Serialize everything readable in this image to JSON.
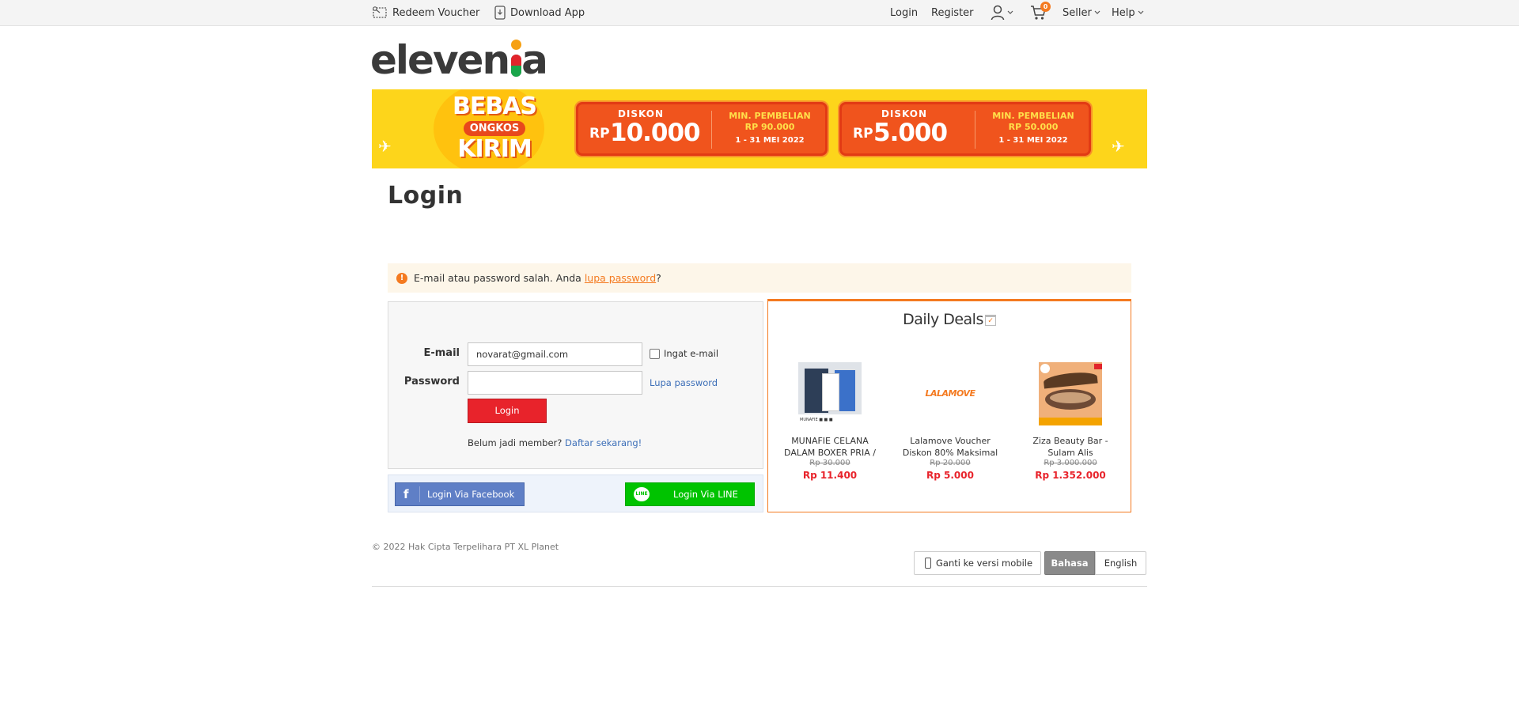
{
  "topbar": {
    "redeem_voucher": "Redeem Voucher",
    "download_app": "Download App",
    "login": "Login",
    "register": "Register",
    "cart_count": "0",
    "seller": "Seller",
    "help": "Help"
  },
  "logo": {
    "text_before": "eleven",
    "text_after": "a"
  },
  "banner": {
    "free_ship_line1": "BEBAS",
    "free_ship_line2": "ONGKOS",
    "free_ship_line3": "KIRIM",
    "vouchers": [
      {
        "label": "DISKON",
        "currency": "RP",
        "amount": "10.000",
        "min_label": "MIN. PEMBELIAN",
        "min_amount": "RP 90.000",
        "period": "1 - 31 MEI 2022"
      },
      {
        "label": "DISKON",
        "currency": "RP",
        "amount": "5.000",
        "min_label": "MIN. PEMBELIAN",
        "min_amount": "RP 50.000",
        "period": "1 - 31 MEI 2022"
      }
    ]
  },
  "page": {
    "title": "Login"
  },
  "alert": {
    "message": "E-mail atau password salah. Anda",
    "link": "lupa password",
    "suffix": "?"
  },
  "form": {
    "email_label": "E-mail",
    "email_value": "novarat@gmail.com",
    "password_label": "Password",
    "password_value": "",
    "remember_label": "Ingat e-mail",
    "remember_checked": false,
    "forgot_label": "Lupa password",
    "login_button": "Login",
    "member_prompt": "Belum jadi member?",
    "register_link": "Daftar sekarang!"
  },
  "social": {
    "facebook_label": "Login Via Facebook",
    "line_label": "Login Via LINE"
  },
  "deals": {
    "title": "Daily Deals",
    "items": [
      {
        "name": "MUNAFIE CELANA DALAM BOXER PRIA /",
        "old_price": "Rp 30.000",
        "price": "Rp 11.400"
      },
      {
        "name": "Lalamove Voucher Diskon 80% Maksimal",
        "old_price": "Rp 20.000",
        "price": "Rp 5.000",
        "image_text": "LALAMOVE"
      },
      {
        "name": "Ziza Beauty Bar - Sulam Alis",
        "old_price": "Rp 3.000.000",
        "price": "Rp 1.352.000"
      }
    ]
  },
  "footer": {
    "copyright": "© 2022 Hak Cipta Terpelihara PT XL Planet",
    "mobile_version": "Ganti ke versi mobile",
    "lang_bahasa": "Bahasa",
    "lang_english": "English"
  },
  "colors": {
    "accent": "#f47a20",
    "login_button": "#e8232b",
    "facebook": "#5f7fc6",
    "line": "#00c300",
    "link": "#3d6fb8",
    "banner_bg": "#fdd51b"
  },
  "icons": {
    "redeem": "voucher-scissors-icon",
    "download": "phone-download-icon",
    "account": "user-icon",
    "cart": "cart-icon",
    "alert": "exclamation-icon",
    "mobile": "phone-icon"
  }
}
